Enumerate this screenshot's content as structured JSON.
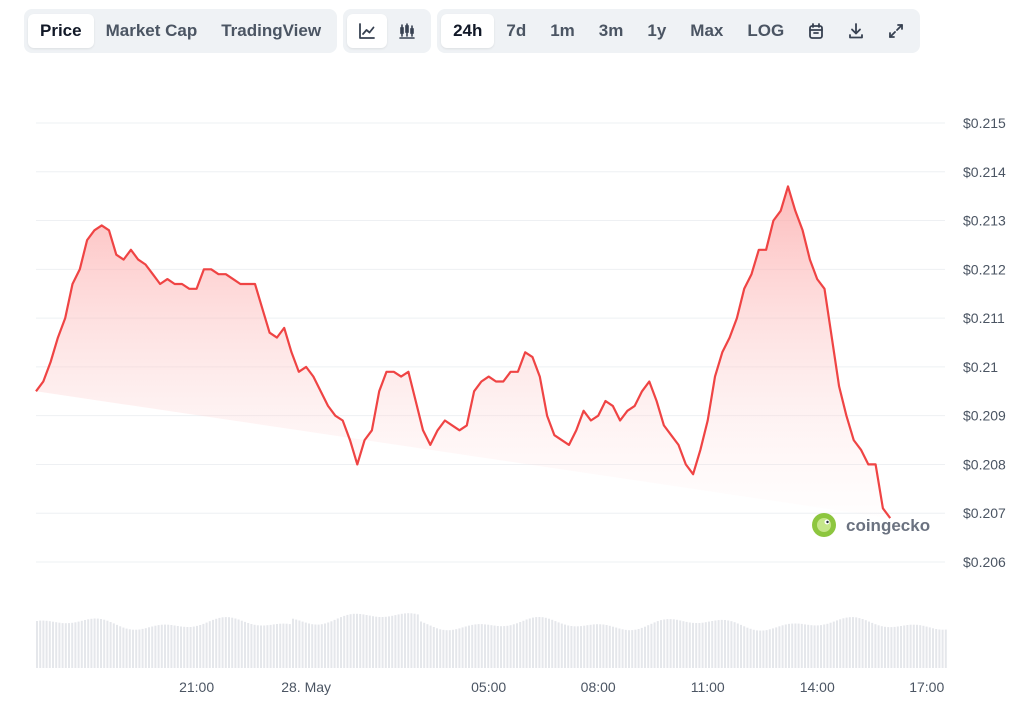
{
  "toolbar": {
    "view_tabs": [
      "Price",
      "Market Cap",
      "TradingView"
    ],
    "active_view": "Price",
    "chart_type_icons": [
      "line-chart-icon",
      "candlestick-icon"
    ],
    "ranges": [
      "24h",
      "7d",
      "1m",
      "3m",
      "1y",
      "Max",
      "LOG"
    ],
    "active_range": "24h",
    "action_icons": [
      "calendar-icon",
      "download-icon",
      "expand-icon"
    ]
  },
  "watermark": "coingecko",
  "colors": {
    "line": "#ef4444",
    "fill_top": "#fca5a5",
    "volume": "#e5e7eb",
    "grid": "#eef0f3"
  },
  "chart_data": {
    "type": "area",
    "title": "",
    "xlabel": "",
    "ylabel": "",
    "currency_prefix": "$",
    "y_ticks": [
      0.206,
      0.207,
      0.208,
      0.209,
      0.21,
      0.211,
      0.212,
      0.213,
      0.214,
      0.215
    ],
    "y_tick_labels": [
      "$0.206",
      "$0.207",
      "$0.208",
      "$0.209",
      "$0.21",
      "$0.211",
      "$0.212",
      "$0.213",
      "$0.214",
      "$0.215"
    ],
    "ylim": [
      0.206,
      0.215
    ],
    "x_tick_labels": [
      "21:00",
      "28. May",
      "05:00",
      "08:00",
      "11:00",
      "14:00",
      "17:00"
    ],
    "x_tick_hours": [
      21,
      24,
      29,
      32,
      35,
      38,
      41
    ],
    "xlim_hours": [
      16.6,
      41.5
    ],
    "grid": true,
    "legend": "none",
    "series": [
      {
        "x_hours": [
          16.6,
          16.8,
          17.0,
          17.2,
          17.4,
          17.6,
          17.8,
          18.0,
          18.2,
          18.4,
          18.6,
          18.8,
          19.0,
          19.2,
          19.4,
          19.6,
          19.8,
          20.0,
          20.2,
          20.4,
          20.6,
          20.8,
          21.0,
          21.2,
          21.4,
          21.6,
          21.8,
          22.0,
          22.2,
          22.4,
          22.6,
          22.8,
          23.0,
          23.2,
          23.4,
          23.6,
          23.8,
          24.0,
          24.2,
          24.4,
          24.6,
          24.8,
          25.0,
          25.2,
          25.4,
          25.6,
          25.8,
          26.0,
          26.2,
          26.4,
          26.6,
          26.8,
          27.0,
          27.2,
          27.4,
          27.6,
          27.8,
          28.0,
          28.2,
          28.4,
          28.6,
          28.8,
          29.0,
          29.2,
          29.4,
          29.6,
          29.8,
          30.0,
          30.2,
          30.4,
          30.6,
          30.8,
          31.0,
          31.2,
          31.4,
          31.6,
          31.8,
          32.0,
          32.2,
          32.4,
          32.6,
          32.8,
          33.0,
          33.2,
          33.4,
          33.6,
          33.8,
          34.0,
          34.2,
          34.4,
          34.6,
          34.8,
          35.0,
          35.2,
          35.4,
          35.6,
          35.8,
          36.0,
          36.2,
          36.4,
          36.6,
          36.8,
          37.0,
          37.2,
          37.4,
          37.6,
          37.8,
          38.0,
          38.2,
          38.4,
          38.6,
          38.8,
          39.0,
          39.2,
          39.4,
          39.6,
          39.8,
          40.0,
          40.2,
          40.4,
          40.6,
          40.8,
          41.0,
          41.2,
          41.4
        ],
        "values": [
          0.2095,
          0.2097,
          0.2101,
          0.2106,
          0.211,
          0.2117,
          0.212,
          0.2126,
          0.2128,
          0.2129,
          0.2128,
          0.2123,
          0.2122,
          0.2124,
          0.2122,
          0.2121,
          0.2119,
          0.2117,
          0.2118,
          0.2117,
          0.2117,
          0.2116,
          0.2116,
          0.212,
          0.212,
          0.2119,
          0.2119,
          0.2118,
          0.2117,
          0.2117,
          0.2117,
          0.2112,
          0.2107,
          0.2106,
          0.2108,
          0.2103,
          0.2099,
          0.21,
          0.2098,
          0.2095,
          0.2092,
          0.209,
          0.2089,
          0.2085,
          0.208,
          0.2085,
          0.2087,
          0.2095,
          0.2099,
          0.2099,
          0.2098,
          0.2099,
          0.2093,
          0.2087,
          0.2084,
          0.2087,
          0.2089,
          0.2088,
          0.2087,
          0.2088,
          0.2095,
          0.2097,
          0.2098,
          0.2097,
          0.2097,
          0.2099,
          0.2099,
          0.2103,
          0.2102,
          0.2098,
          0.209,
          0.2086,
          0.2085,
          0.2084,
          0.2087,
          0.2091,
          0.2089,
          0.209,
          0.2093,
          0.2092,
          0.2089,
          0.2091,
          0.2092,
          0.2095,
          0.2097,
          0.2093,
          0.2088,
          0.2086,
          0.2084,
          0.208,
          0.2078,
          0.2083,
          0.2089,
          0.2098,
          0.2103,
          0.2106,
          0.211,
          0.2116,
          0.2119,
          0.2124,
          0.2124,
          0.213,
          0.2132,
          0.2137,
          0.2132,
          0.2128,
          0.2122,
          0.2118,
          0.2116,
          0.2106,
          0.2096,
          0.209,
          0.2085,
          0.2083,
          0.208,
          0.208,
          0.2071,
          0.2069
        ]
      }
    ]
  }
}
